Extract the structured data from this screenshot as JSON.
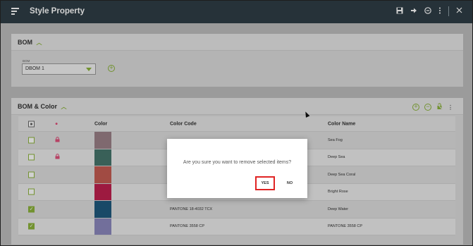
{
  "window": {
    "title": "Style Property",
    "icons": [
      "menu-icon",
      "save-icon",
      "forward-icon",
      "remove-icon",
      "more-icon",
      "close-icon"
    ]
  },
  "bom_panel": {
    "title": "BOM",
    "field_label": "BOM",
    "selected_value": "DBOM 1"
  },
  "bom_color_panel": {
    "title": "BOM & Color",
    "columns": [
      "Color",
      "Color Code",
      "Color Name"
    ],
    "rows": [
      {
        "checked": false,
        "locked": true,
        "swatch": "#9b8088",
        "code": "",
        "name": "Sea Fog"
      },
      {
        "checked": false,
        "locked": true,
        "swatch": "#46766c",
        "code": "",
        "name": "Deep Sea"
      },
      {
        "checked": false,
        "locked": false,
        "swatch": "#c55c52",
        "code": "",
        "name": "Deep Sea Coral"
      },
      {
        "checked": false,
        "locked": false,
        "swatch": "#c0204f",
        "code": "",
        "name": "Bright Rose"
      },
      {
        "checked": true,
        "locked": false,
        "swatch": "#1f5a7e",
        "code": "PANTONE 18-4032 TCX",
        "name": "Deep Water"
      },
      {
        "checked": true,
        "locked": false,
        "swatch": "#8c88be",
        "code": "PANTONE 3558 CP",
        "name": "PANTONE 3558 CP"
      }
    ]
  },
  "dialog": {
    "message": "Are you sure you want to remove selected items?",
    "yes_label": "YES",
    "no_label": "NO"
  },
  "colors": {
    "accent": "#8bb33a",
    "titlebar": "#2f3e46",
    "highlight": "#e02424"
  }
}
